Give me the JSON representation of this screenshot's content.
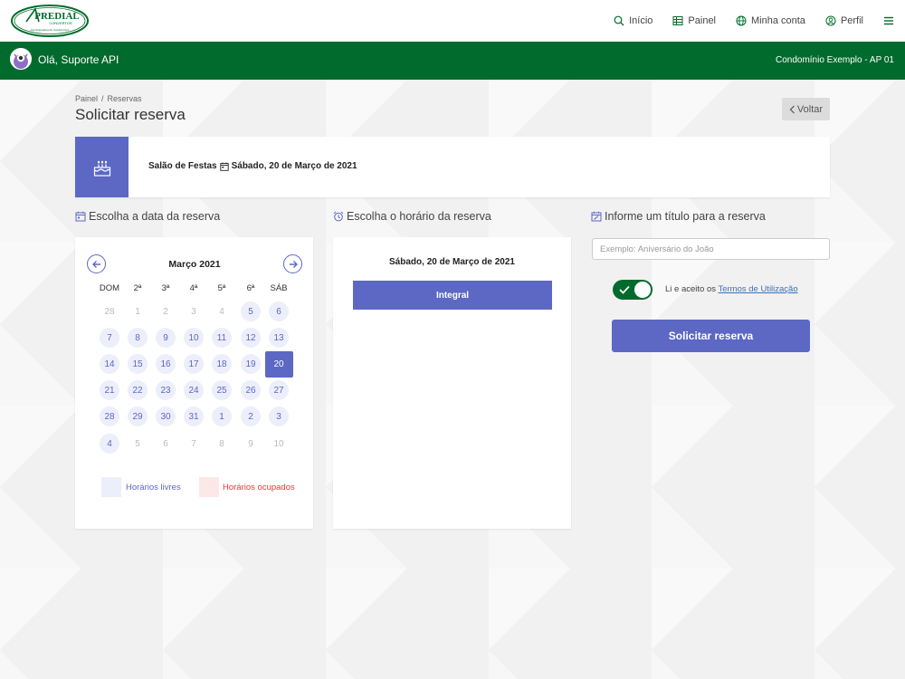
{
  "logo": {
    "brand": "PREDIAL",
    "sub": "CONVERTOS",
    "tagline": "Administradora de Condomínios"
  },
  "nav": {
    "items": [
      {
        "label": "Início",
        "icon": "search-icon"
      },
      {
        "label": "Painel",
        "icon": "table-icon"
      },
      {
        "label": "Minha conta",
        "icon": "globe-icon"
      },
      {
        "label": "Perfil",
        "icon": "user-circle-icon"
      }
    ],
    "menu_icon": "hamburger-icon"
  },
  "header": {
    "greeting": "Olá, Suporte API",
    "condo": "Condomínio Exemplo - AP 01"
  },
  "breadcrumb": [
    "Painel",
    "Reservas"
  ],
  "page_title": "Solicitar reserva",
  "back_label": "Voltar",
  "summary": {
    "place": "Salão de Festas",
    "date": "Sábado, 20 de Março de 2021"
  },
  "sections": {
    "date": "Escolha a data da reserva",
    "time": "Escolha o horário da reserva",
    "title": "Informe um título para a reserva"
  },
  "calendar": {
    "month": "Março 2021",
    "weekdays": [
      "DOM",
      "2ª",
      "3ª",
      "4ª",
      "5ª",
      "6ª",
      "SÁB"
    ],
    "weeks": [
      [
        {
          "d": "28",
          "s": "muted"
        },
        {
          "d": "1",
          "s": "muted"
        },
        {
          "d": "2",
          "s": "muted"
        },
        {
          "d": "3",
          "s": "muted"
        },
        {
          "d": "4",
          "s": "muted"
        },
        {
          "d": "5",
          "s": "free"
        },
        {
          "d": "6",
          "s": "free"
        }
      ],
      [
        {
          "d": "7",
          "s": "free"
        },
        {
          "d": "8",
          "s": "free"
        },
        {
          "d": "9",
          "s": "free"
        },
        {
          "d": "10",
          "s": "free"
        },
        {
          "d": "11",
          "s": "free"
        },
        {
          "d": "12",
          "s": "free"
        },
        {
          "d": "13",
          "s": "free"
        }
      ],
      [
        {
          "d": "14",
          "s": "free"
        },
        {
          "d": "15",
          "s": "free"
        },
        {
          "d": "16",
          "s": "free"
        },
        {
          "d": "17",
          "s": "free"
        },
        {
          "d": "18",
          "s": "free"
        },
        {
          "d": "19",
          "s": "free"
        },
        {
          "d": "20",
          "s": "selected"
        }
      ],
      [
        {
          "d": "21",
          "s": "free"
        },
        {
          "d": "22",
          "s": "free"
        },
        {
          "d": "23",
          "s": "free"
        },
        {
          "d": "24",
          "s": "free"
        },
        {
          "d": "25",
          "s": "free"
        },
        {
          "d": "26",
          "s": "free"
        },
        {
          "d": "27",
          "s": "free"
        }
      ],
      [
        {
          "d": "28",
          "s": "free"
        },
        {
          "d": "29",
          "s": "free"
        },
        {
          "d": "30",
          "s": "free"
        },
        {
          "d": "31",
          "s": "free"
        },
        {
          "d": "1",
          "s": "free"
        },
        {
          "d": "2",
          "s": "free"
        },
        {
          "d": "3",
          "s": "free"
        }
      ],
      [
        {
          "d": "4",
          "s": "free"
        },
        {
          "d": "5",
          "s": "muted"
        },
        {
          "d": "6",
          "s": "muted"
        },
        {
          "d": "7",
          "s": "muted"
        },
        {
          "d": "8",
          "s": "muted"
        },
        {
          "d": "9",
          "s": "muted"
        },
        {
          "d": "10",
          "s": "muted"
        }
      ]
    ],
    "legend": {
      "free": "Horários livres",
      "busy": "Horários ocupados"
    }
  },
  "time": {
    "date": "Sábado, 20 de Março de 2021",
    "slot": "Integral"
  },
  "form": {
    "placeholder": "Exemplo: Aniversário do João",
    "terms_prefix": "Li e aceito os",
    "terms_link": "Termos de Utilização",
    "submit": "Solicitar reserva",
    "accepted": true
  },
  "colors": {
    "brand_green": "#006b2c",
    "accent": "#5c68c4",
    "free_bg": "#eceefa",
    "busy_bg": "#fde8e8",
    "busy_text": "#e53935"
  }
}
